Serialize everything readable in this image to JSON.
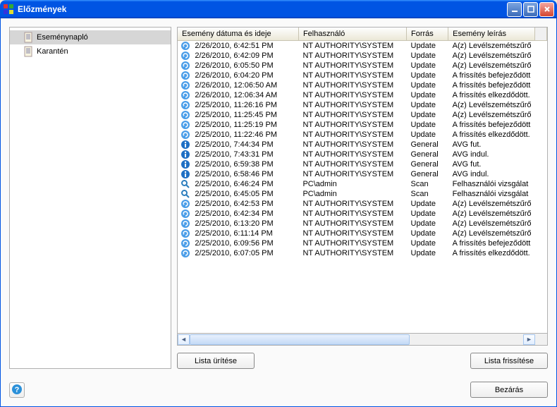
{
  "window": {
    "title": "Előzmények"
  },
  "sidebar": {
    "items": [
      {
        "label": "Eseménynapló",
        "selected": true
      },
      {
        "label": "Karantén",
        "selected": false
      }
    ]
  },
  "table": {
    "columns": {
      "date": "Esemény dátuma és ideje",
      "user": "Felhasználó",
      "source": "Forrás",
      "desc": "Esemény leírás"
    },
    "rows": [
      {
        "icon": "update",
        "date": "2/26/2010, 6:42:51 PM",
        "user": "NT AUTHORITY\\SYSTEM",
        "source": "Update",
        "desc": "A(z) Levélszemétszűrő"
      },
      {
        "icon": "update",
        "date": "2/26/2010, 6:42:09 PM",
        "user": "NT AUTHORITY\\SYSTEM",
        "source": "Update",
        "desc": "A(z) Levélszemétszűrő"
      },
      {
        "icon": "update",
        "date": "2/26/2010, 6:05:50 PM",
        "user": "NT AUTHORITY\\SYSTEM",
        "source": "Update",
        "desc": "A(z) Levélszemétszűrő"
      },
      {
        "icon": "update",
        "date": "2/26/2010, 6:04:20 PM",
        "user": "NT AUTHORITY\\SYSTEM",
        "source": "Update",
        "desc": "A frissítés befejeződött"
      },
      {
        "icon": "update",
        "date": "2/26/2010, 12:06:50 AM",
        "user": "NT AUTHORITY\\SYSTEM",
        "source": "Update",
        "desc": "A frissítés befejeződött"
      },
      {
        "icon": "update",
        "date": "2/26/2010, 12:06:34 AM",
        "user": "NT AUTHORITY\\SYSTEM",
        "source": "Update",
        "desc": "A frissítés elkezdődött."
      },
      {
        "icon": "update",
        "date": "2/25/2010, 11:26:16 PM",
        "user": "NT AUTHORITY\\SYSTEM",
        "source": "Update",
        "desc": "A(z) Levélszemétszűrő"
      },
      {
        "icon": "update",
        "date": "2/25/2010, 11:25:45 PM",
        "user": "NT AUTHORITY\\SYSTEM",
        "source": "Update",
        "desc": "A(z) Levélszemétszűrő"
      },
      {
        "icon": "update",
        "date": "2/25/2010, 11:25:19 PM",
        "user": "NT AUTHORITY\\SYSTEM",
        "source": "Update",
        "desc": "A frissítés befejeződött"
      },
      {
        "icon": "update",
        "date": "2/25/2010, 11:22:46 PM",
        "user": "NT AUTHORITY\\SYSTEM",
        "source": "Update",
        "desc": "A frissítés elkezdődött."
      },
      {
        "icon": "info",
        "date": "2/25/2010, 7:44:34 PM",
        "user": "NT AUTHORITY\\SYSTEM",
        "source": "General",
        "desc": "AVG fut."
      },
      {
        "icon": "info",
        "date": "2/25/2010, 7:43:31 PM",
        "user": "NT AUTHORITY\\SYSTEM",
        "source": "General",
        "desc": "AVG indul."
      },
      {
        "icon": "info",
        "date": "2/25/2010, 6:59:38 PM",
        "user": "NT AUTHORITY\\SYSTEM",
        "source": "General",
        "desc": "AVG fut."
      },
      {
        "icon": "info",
        "date": "2/25/2010, 6:58:46 PM",
        "user": "NT AUTHORITY\\SYSTEM",
        "source": "General",
        "desc": "AVG indul."
      },
      {
        "icon": "scan",
        "date": "2/25/2010, 6:46:24 PM",
        "user": "PC\\admin",
        "source": "Scan",
        "desc": "Felhasználói vizsgálat"
      },
      {
        "icon": "scan",
        "date": "2/25/2010, 6:45:05 PM",
        "user": "PC\\admin",
        "source": "Scan",
        "desc": "Felhasználói vizsgálat"
      },
      {
        "icon": "update",
        "date": "2/25/2010, 6:42:53 PM",
        "user": "NT AUTHORITY\\SYSTEM",
        "source": "Update",
        "desc": "A(z) Levélszemétszűrő"
      },
      {
        "icon": "update",
        "date": "2/25/2010, 6:42:34 PM",
        "user": "NT AUTHORITY\\SYSTEM",
        "source": "Update",
        "desc": "A(z) Levélszemétszűrő"
      },
      {
        "icon": "update",
        "date": "2/25/2010, 6:13:20 PM",
        "user": "NT AUTHORITY\\SYSTEM",
        "source": "Update",
        "desc": "A(z) Levélszemétszűrő"
      },
      {
        "icon": "update",
        "date": "2/25/2010, 6:11:14 PM",
        "user": "NT AUTHORITY\\SYSTEM",
        "source": "Update",
        "desc": "A(z) Levélszemétszűrő"
      },
      {
        "icon": "update",
        "date": "2/25/2010, 6:09:56 PM",
        "user": "NT AUTHORITY\\SYSTEM",
        "source": "Update",
        "desc": "A frissítés befejeződött"
      },
      {
        "icon": "update",
        "date": "2/25/2010, 6:07:05 PM",
        "user": "NT AUTHORITY\\SYSTEM",
        "source": "Update",
        "desc": "A frissítés elkezdődött."
      }
    ]
  },
  "buttons": {
    "clear": "Lista ürítése",
    "refresh": "Lista frissítése",
    "close": "Bezárás"
  }
}
